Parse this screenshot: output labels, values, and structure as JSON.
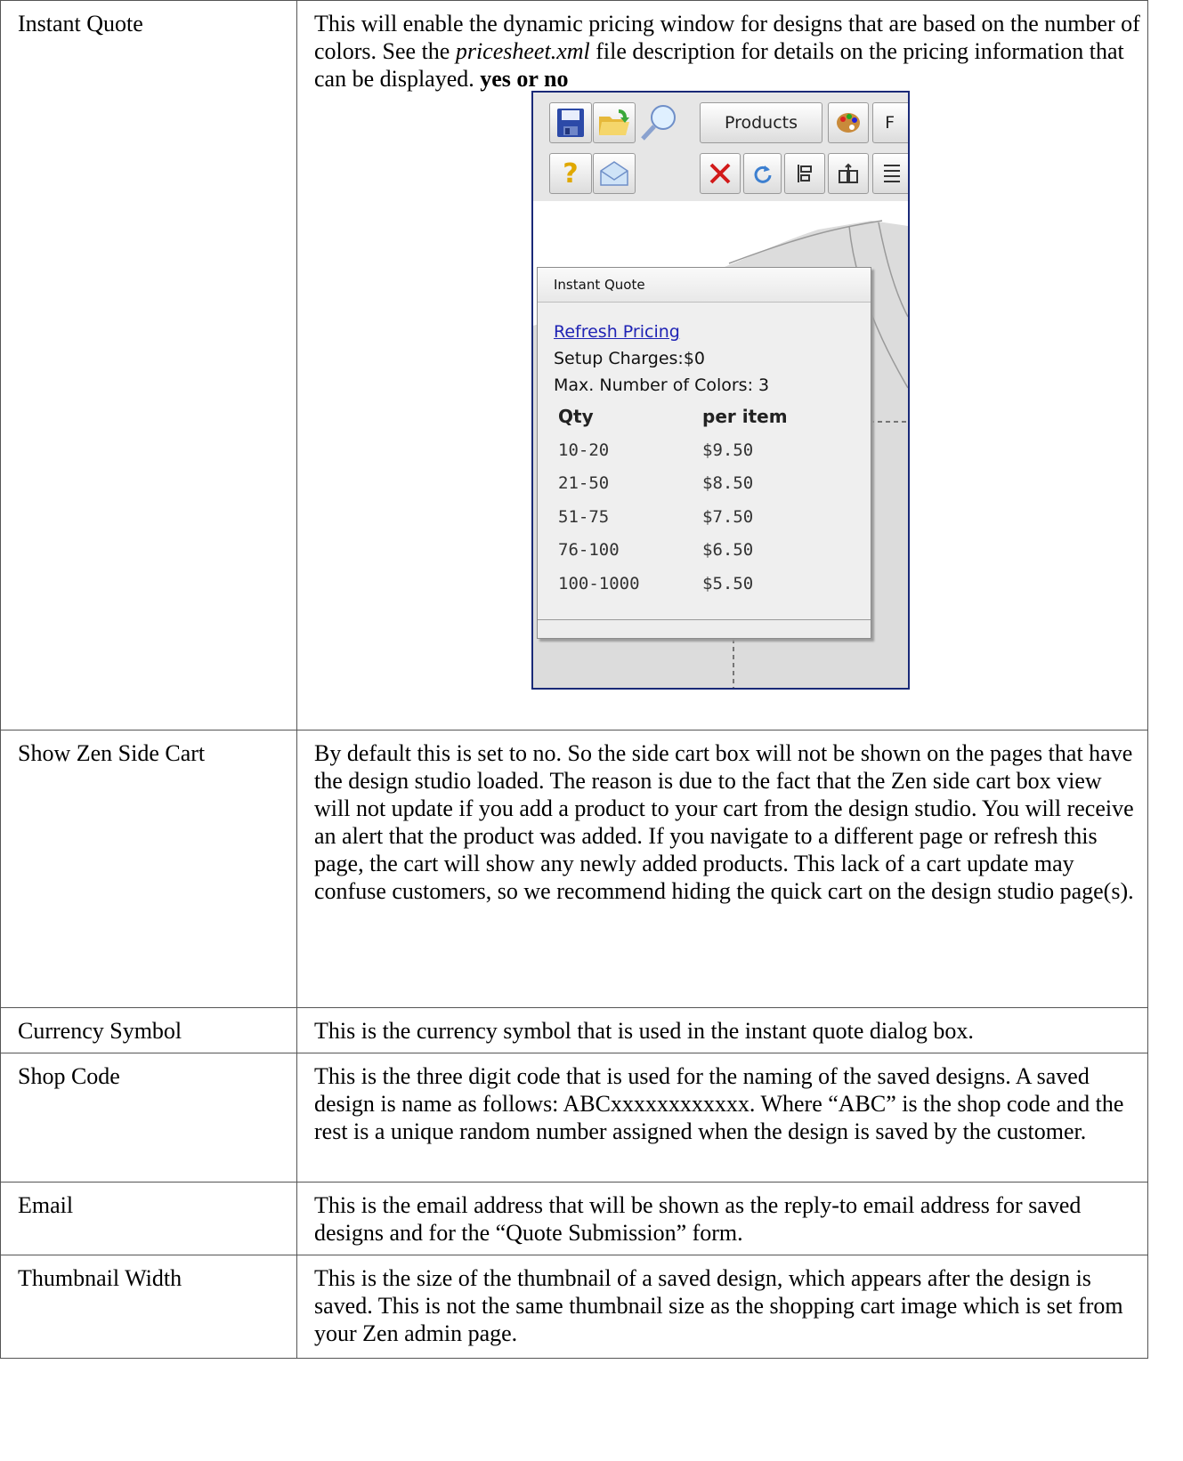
{
  "rows": [
    {
      "label": "Instant Quote",
      "desc": {
        "p1": "This will enable the dynamic pricing window for designs that are based on the number of colors. See the ",
        "file": "pricesheet.xml",
        "p2": " file description for details on the pricing information that can be displayed. ",
        "options": "yes or no"
      }
    },
    {
      "label": "Show Zen Side Cart",
      "desc": "By default this is set to no. So the side cart box will not be shown on the pages that have the design studio loaded. The reason is due to the fact that the Zen side cart box view will not update if you add a product to your cart from the design studio. You will receive an alert that the product was added. If you navigate to a different page or refresh this page, the cart will show any newly added products. This lack of a cart update may confuse customers, so we recommend hiding the quick cart on the design studio page(s)."
    },
    {
      "label": "Currency Symbol",
      "desc": "This is the currency symbol that is used in the instant quote dialog box."
    },
    {
      "label": "Shop Code",
      "desc": "This is the three digit code that is used for the naming of the saved designs. A saved design is name as follows: ABCxxxxxxxxxxxx. Where “ABC” is the shop code and the rest is a unique random number assigned when the design is saved by the customer."
    },
    {
      "label": "Email",
      "desc": "This is the email address that will be shown as the reply-to email address for saved designs and for the “Quote Submission” form."
    },
    {
      "label": "Thumbnail Width",
      "desc": "This is the size of the thumbnail of a saved design, which appears after the design is saved. This is not the same thumbnail size as the shopping cart image which is set from your Zen admin page."
    }
  ],
  "screenshot": {
    "toolbar": {
      "products_label": "Products",
      "cut_label": "F",
      "icons_row1": [
        "save-icon",
        "open-folder-icon",
        "zoom-icon",
        "palette-icon"
      ],
      "icons_row2": [
        "help-icon",
        "email-icon",
        "delete-icon",
        "rotate-icon",
        "align-icon",
        "flip-icon",
        "text-align-icon"
      ]
    },
    "quote_window": {
      "title": "Instant Quote",
      "refresh_link": "Refresh Pricing",
      "setup_charges": "Setup Charges:$0",
      "max_colors": "Max. Number of Colors: 3",
      "col_qty": "Qty",
      "col_price": "per item",
      "prices": [
        {
          "qty": "10-20",
          "price": "$9.50"
        },
        {
          "qty": "21-50",
          "price": "$8.50"
        },
        {
          "qty": "51-75",
          "price": "$7.50"
        },
        {
          "qty": "76-100",
          "price": "$6.50"
        },
        {
          "qty": "100-1000",
          "price": "$5.50"
        }
      ]
    }
  }
}
